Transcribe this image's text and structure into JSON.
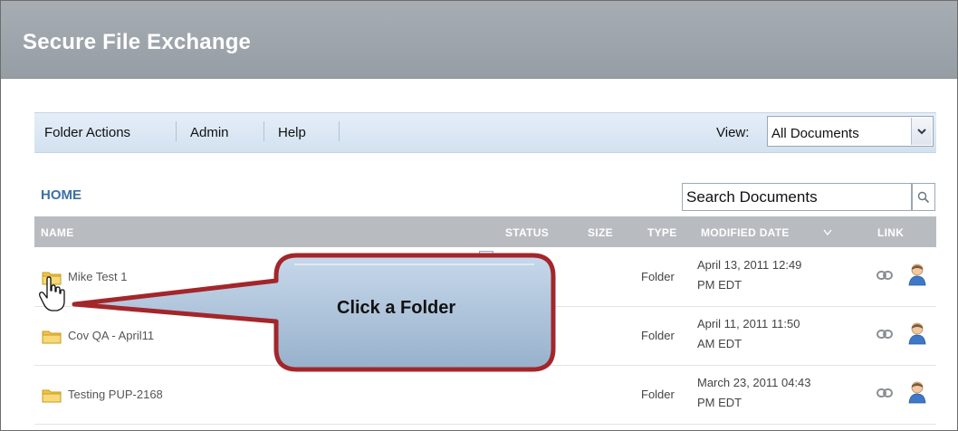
{
  "app": {
    "title": "Secure File Exchange"
  },
  "toolbar": {
    "menu": [
      "Folder Actions",
      "Admin",
      "Help"
    ],
    "view_label": "View:",
    "view_value": "All Documents"
  },
  "breadcrumb": {
    "home": "HOME"
  },
  "search": {
    "value": "Search Documents"
  },
  "table": {
    "columns": {
      "name": "NAME",
      "status": "STATUS",
      "size": "SIZE",
      "type": "TYPE",
      "modified": "MODIFIED DATE",
      "link": "LINK"
    },
    "rows": [
      {
        "name": "Mike Test 1",
        "type": "Folder",
        "modified_line1": "April 13, 2011 12:49",
        "modified_line2": "PM EDT"
      },
      {
        "name": "Cov QA - April11",
        "type": "Folder",
        "modified_line1": "April 11, 2011 11:50",
        "modified_line2": "AM EDT"
      },
      {
        "name": "Testing PUP-2168",
        "type": "Folder",
        "modified_line1": "March 23, 2011 04:43",
        "modified_line2": "PM EDT"
      }
    ]
  },
  "callout": {
    "text": "Click a Folder"
  },
  "colors": {
    "title_bar": "#9ca3aa",
    "toolbar": "#dbe6f2",
    "table_header": "#b8bcc1",
    "home_link": "#3d6fa8",
    "callout_border": "#a3262a",
    "callout_fill": "#a9bfd6"
  },
  "icons": {
    "folder": "folder-icon",
    "link": "chain-link-icon",
    "user": "user-icon",
    "search": "magnifier-icon",
    "sort": "sort-down-icon",
    "dropdown": "chevron-down-icon",
    "cursor": "hand-pointer-icon"
  }
}
